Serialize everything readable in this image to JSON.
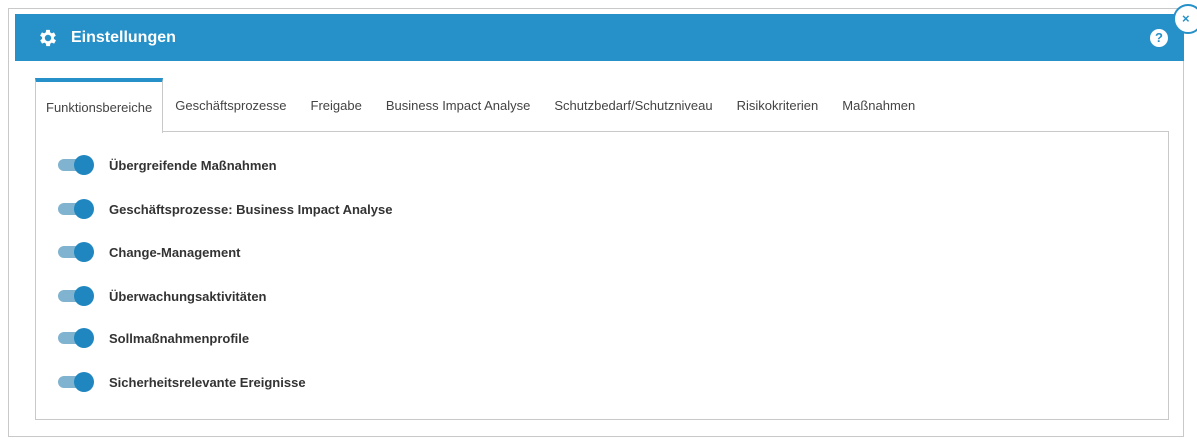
{
  "dialog": {
    "title": "Einstellungen",
    "help_label": "?",
    "close_label": "×"
  },
  "tabs": [
    {
      "label": "Funktionsbereiche",
      "active": true
    },
    {
      "label": "Geschäftsprozesse",
      "active": false
    },
    {
      "label": "Freigabe",
      "active": false
    },
    {
      "label": "Business Impact Analyse",
      "active": false
    },
    {
      "label": "Schutzbedarf/Schutzniveau",
      "active": false
    },
    {
      "label": "Risikokriterien",
      "active": false
    },
    {
      "label": "Maßnahmen",
      "active": false
    }
  ],
  "toggles": [
    {
      "label": "Übergreifende Maßnahmen",
      "on": true
    },
    {
      "label": "Geschäftsprozesse: Business Impact Analyse",
      "on": true
    },
    {
      "label": "Change-Management",
      "on": true
    },
    {
      "label": "Überwachungsaktivitäten",
      "on": true
    },
    {
      "label": "Sollmaßnahmenprofile",
      "on": true
    },
    {
      "label": "Sicherheitsrelevante Ereignisse",
      "on": true
    }
  ],
  "colors": {
    "accent": "#2691c8",
    "switch_knob": "#1f86c0",
    "switch_track": "#7fb3cf"
  },
  "icons": {
    "title": "gear-icon",
    "help": "question-circle-icon",
    "close": "close-icon"
  }
}
